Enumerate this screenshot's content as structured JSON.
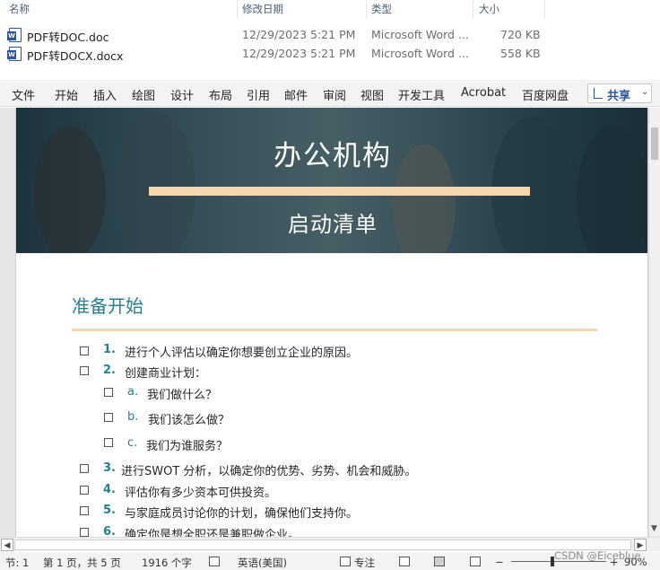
{
  "explorer": {
    "columns": {
      "name": "名称",
      "modified": "修改日期",
      "type": "类型",
      "size": "大小"
    },
    "files": [
      {
        "name": "PDF转DOC.doc",
        "modified": "12/29/2023 5:21 PM",
        "type": "Microsoft Word ...",
        "size": "720 KB",
        "icon": "word-doc-icon"
      },
      {
        "name": "PDF转DOCX.docx",
        "modified": "12/29/2023 5:21 PM",
        "type": "Microsoft Word ...",
        "size": "558 KB",
        "icon": "word-docx-icon"
      }
    ]
  },
  "ribbon": {
    "tabs": [
      "文件",
      "开始",
      "插入",
      "绘图",
      "设计",
      "布局",
      "引用",
      "邮件",
      "审阅",
      "视图",
      "开发工具",
      "Acrobat",
      "百度网盘"
    ],
    "share_label": "共享"
  },
  "document": {
    "banner_title": "办公机构",
    "banner_subtitle": "启动清单",
    "section_heading": "准备开始",
    "items": [
      {
        "num": "1.",
        "text": "进行个人评估以确定你想要创立企业的原因。"
      },
      {
        "num": "2.",
        "text": "创建商业计划："
      },
      {
        "num": "a.",
        "text": "我们做什么？"
      },
      {
        "num": "b.",
        "text": "我们该怎么做？"
      },
      {
        "num": "c.",
        "text": "我们为谁服务？"
      },
      {
        "num": "3.",
        "text": "进行SWOT 分析，以确定你的优势、劣势、机会和威胁。"
      },
      {
        "num": "4.",
        "text": "评估你有多少资本可供投资。"
      },
      {
        "num": "5.",
        "text": "与家庭成员讨论你的计划，确保他们支持你。"
      },
      {
        "num": "6.",
        "text": "确定你是想全职还是兼职做企业。"
      }
    ]
  },
  "statusbar": {
    "section": "节: 1",
    "page": "第 1 页，共 5 页",
    "words": "1916 个字",
    "language": "英语(美国)",
    "focus": "专注",
    "zoom": "90%"
  },
  "watermark": "CSDN @Eiceblue",
  "colors": {
    "accent_teal": "#2a7f8f",
    "accent_peach": "#f6d7ad",
    "word_blue": "#2b579a"
  }
}
